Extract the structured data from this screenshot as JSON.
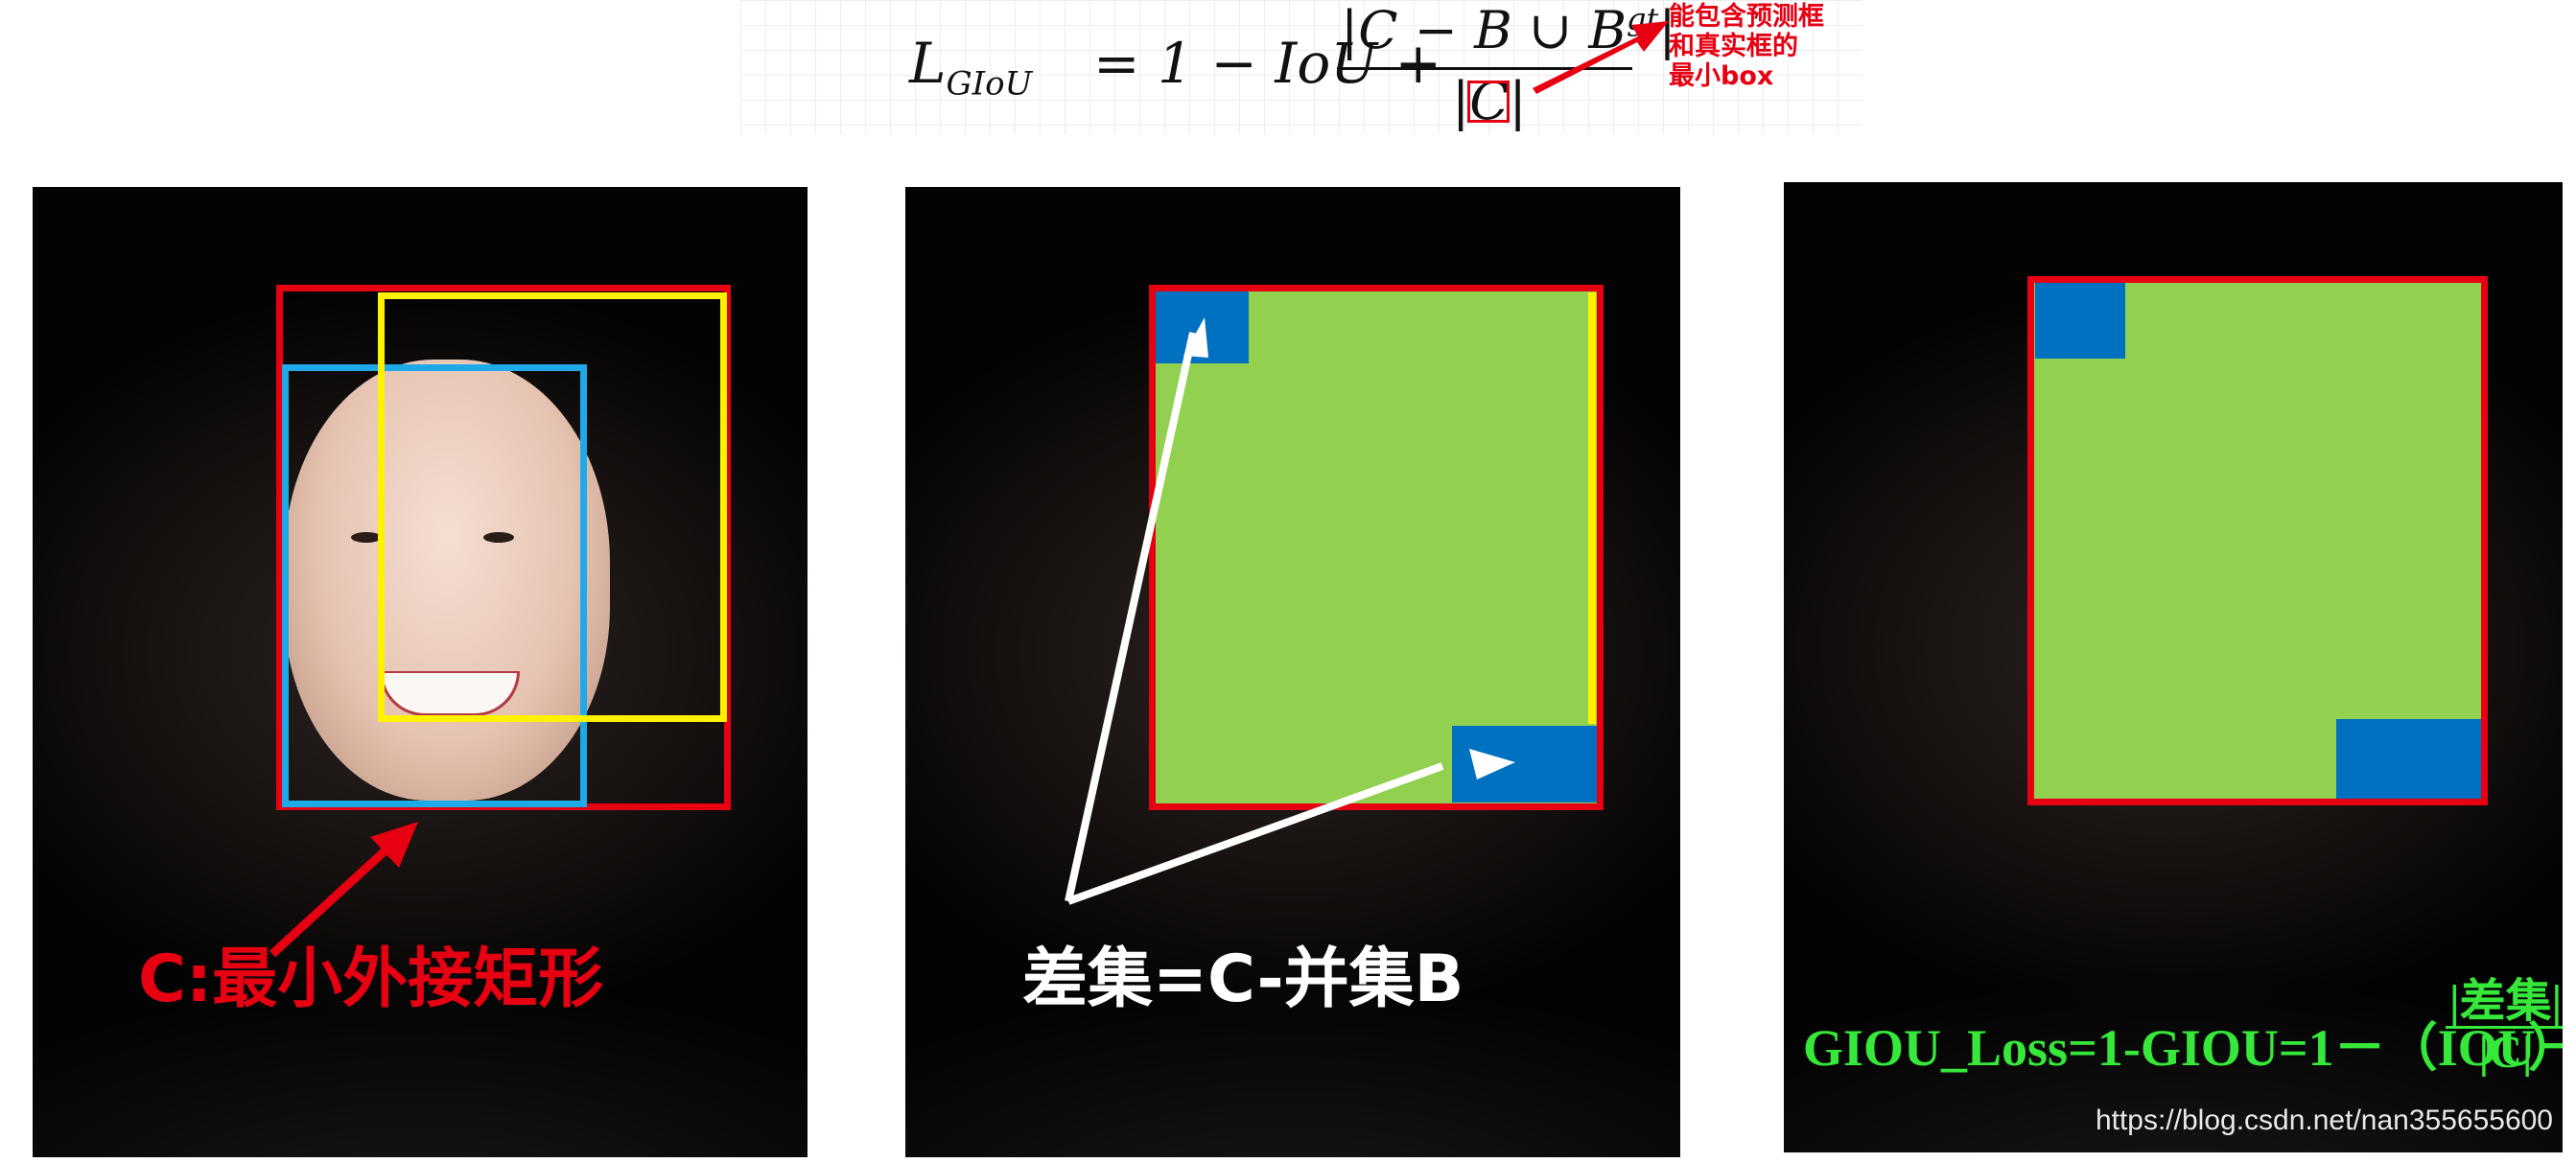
{
  "formula": {
    "lhs": "L",
    "lhs_sub": "GIoU",
    "rhs": "= 1 − IoU +",
    "numerator_main": "|C − B ∪ B",
    "numerator_sup": "gt",
    "numerator_close": "|",
    "denominator": "|C|",
    "annotation_lines": [
      "能包含预测框",
      "和真实框的",
      "最小box"
    ]
  },
  "panels": [
    {
      "label": "C:最小外接矩形",
      "label_color": "#e60012"
    },
    {
      "label": "差集=C-并集B",
      "label_color": "#ffffff"
    },
    {
      "formula_main": "GIOU_Loss=1-GIOU=1－（IOU－",
      "formula_num": "|差集|",
      "formula_den": "|C|",
      "formula_close": "）",
      "formula_color": "#36e83a"
    }
  ],
  "watermark": "https://blog.csdn.net/nan355655600",
  "colors": {
    "enclosing_box": "#e60012",
    "predicted_box": "#fff200",
    "ground_truth_box": "#1eaae8",
    "union_fill": "#92d050",
    "difference_fill": "#0070c0"
  }
}
